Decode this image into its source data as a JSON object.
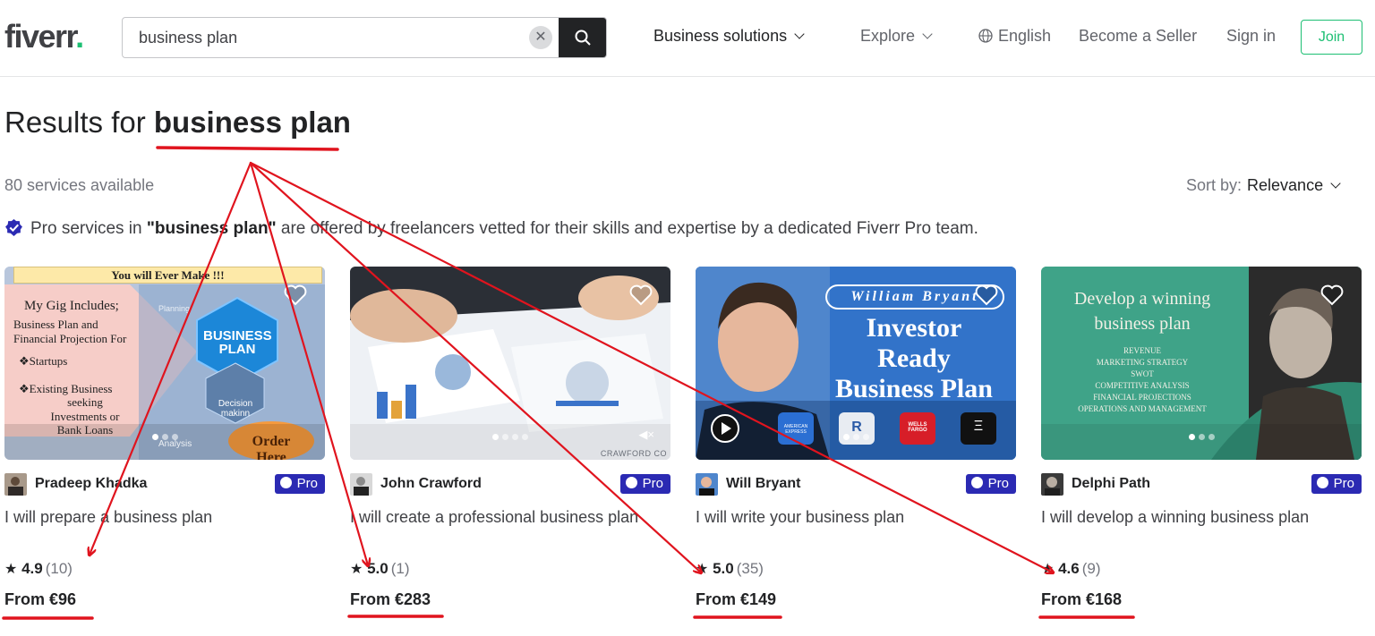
{
  "header": {
    "logo_text": "fiverr",
    "logo_dot": ".",
    "search_value": "business plan",
    "nav": {
      "business_solutions": "Business solutions",
      "explore": "Explore",
      "language": "English",
      "become_seller": "Become a Seller",
      "sign_in": "Sign in",
      "join": "Join"
    }
  },
  "results": {
    "prefix": "Results for ",
    "query": "business plan",
    "count_text": "80 services available",
    "sort_label": "Sort by:",
    "sort_value": "Relevance",
    "pro_note_pre": "Pro services in ",
    "pro_note_query": "\"business plan\"",
    "pro_note_post": " are offered by freelancers vetted for their skills and expertise by a dedicated Fiverr Pro team."
  },
  "gigs": [
    {
      "seller": "Pradeep Khadka",
      "badge": "Pro",
      "title": "I will prepare a business plan",
      "rating": "4.9",
      "reviews": "(10)",
      "price": "From €96",
      "thumb": {
        "banner": "You will Ever Make !!!",
        "heading": "My Gig Includes;",
        "lines": [
          "Business Plan and",
          "Financial Projection For",
          "❖Startups",
          "❖Existing Business",
          "seeking",
          "Investments or",
          "Bank Loans"
        ],
        "hex_label": "BUSINESS PLAN",
        "small_labels": [
          "Planning",
          "Decision makinn",
          "Analysis"
        ],
        "cloud": "Order Here"
      }
    },
    {
      "seller": "John Crawford",
      "badge": "Pro",
      "title": "I will create a professional business plan",
      "rating": "5.0",
      "reviews": "(1)",
      "price": "From €283",
      "thumb": {
        "watermark": "CRAWFORD CO",
        "mute": "◀×"
      }
    },
    {
      "seller": "Will Bryant",
      "badge": "Pro",
      "title": "I will write your business plan",
      "rating": "5.0",
      "reviews": "(35)",
      "price": "From €149",
      "thumb": {
        "name_banner": "William Bryant",
        "headline": [
          "Investor",
          "Ready",
          "Business Plan"
        ],
        "logos": [
          "AMERICAN EXPRESS",
          "R",
          "WELLS FARGO",
          "Ξ"
        ]
      }
    },
    {
      "seller": "Delphi Path",
      "badge": "Pro",
      "title": "I will develop a winning business plan",
      "rating": "4.6",
      "reviews": "(9)",
      "price": "From €168",
      "thumb": {
        "headline": [
          "Develop a winning",
          "business plan"
        ],
        "bullets": [
          "REVENUE",
          "MARKETING STRATEGY",
          "SWOT",
          "COMPETITIVE ANALYSIS",
          "FINANCIAL PROJECTIONS",
          "OPERATIONS AND MANAGEMENT"
        ]
      }
    }
  ],
  "colors": {
    "brand_green": "#1dbf73",
    "pro_badge": "#2b2ab3",
    "annotation_red": "#e0141e"
  }
}
